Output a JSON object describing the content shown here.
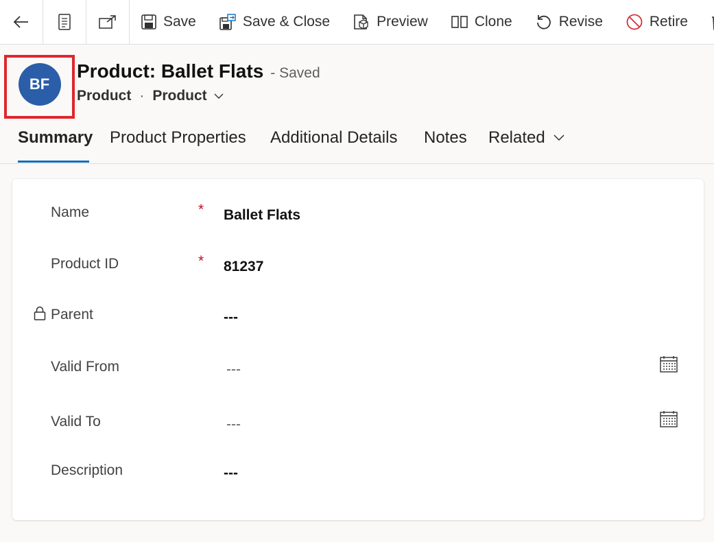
{
  "command_bar": {
    "save": "Save",
    "save_close": "Save & Close",
    "preview": "Preview",
    "clone": "Clone",
    "revise": "Revise",
    "retire": "Retire"
  },
  "header": {
    "avatar_initials": "BF",
    "title": "Product: Ballet Flats",
    "status": "- Saved",
    "entity": "Product",
    "separator": "·",
    "form_name": "Product"
  },
  "tabs": [
    {
      "label": "Summary",
      "active": true
    },
    {
      "label": "Product Properties",
      "active": false
    },
    {
      "label": "Additional Details",
      "active": false
    },
    {
      "label": "Notes",
      "active": false
    },
    {
      "label": "Related",
      "active": false
    }
  ],
  "form": {
    "fields": [
      {
        "label": "Name",
        "required": "*",
        "value": "Ballet Flats"
      },
      {
        "label": "Product ID",
        "required": "*",
        "value": "81237"
      },
      {
        "label": "Parent",
        "value": "---",
        "locked": true
      },
      {
        "label": "Valid From",
        "value": "---",
        "date": true
      },
      {
        "label": "Valid To",
        "value": "---",
        "date": true
      },
      {
        "label": "Description",
        "value": "---"
      }
    ]
  },
  "colors": {
    "accent": "#0f6cbd",
    "avatar": "#2b5ea8",
    "required": "#c50f1f",
    "highlight_box": "#e0262c"
  }
}
